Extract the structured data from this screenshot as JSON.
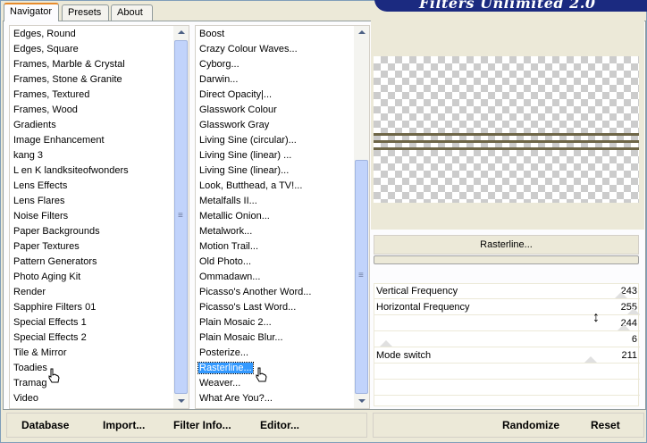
{
  "banner_title": "Filters Unlimited 2.0",
  "tabs": [
    {
      "label": "Navigator"
    },
    {
      "label": "Presets"
    },
    {
      "label": "About"
    }
  ],
  "categories": [
    "Edges, Round",
    "Edges, Square",
    "Frames, Marble & Crystal",
    "Frames, Stone & Granite",
    "Frames, Textured",
    "Frames, Wood",
    "Gradients",
    "Image Enhancement",
    "kang 3",
    "L en K landksiteofwonders",
    "Lens Effects",
    "Lens Flares",
    "Noise Filters",
    "Paper Backgrounds",
    "Paper Textures",
    "Pattern Generators",
    "Photo Aging Kit",
    "Render",
    "Sapphire Filters 01",
    "Special Effects 1",
    "Special Effects 2",
    "Tile & Mirror",
    "Toadies",
    "Tramag",
    "Video"
  ],
  "filters": [
    "Boost",
    "Crazy Colour Waves...",
    "Cyborg...",
    "Darwin...",
    "Direct Opacity|...",
    "Glasswork Colour",
    "Glasswork Gray",
    "Living Sine (circular)...",
    "Living Sine (linear) ...",
    "Living Sine (linear)...",
    "Look, Butthead, a TV!...",
    "Metalfalls II...",
    "Metallic Onion...",
    "Metalwork...",
    "Motion Trail...",
    "Old Photo...",
    "Ommadawn...",
    "Picasso's Another Word...",
    "Picasso's Last Word...",
    "Plain Mosaic 2...",
    "Plain Mosaic Blur...",
    "Posterize...",
    "Rasterline...",
    "Weaver...",
    "What Are You?..."
  ],
  "selected_filter_index": 22,
  "filter_name": "Rasterline...",
  "sliders": [
    {
      "label": "Vertical Frequency",
      "value": "243",
      "level": 0.95
    },
    {
      "label": "Horizontal Frequency",
      "value": "255",
      "level": 1.0
    },
    {
      "label": "",
      "value": "244",
      "level": 0.96
    },
    {
      "label": "",
      "value": "6",
      "level": 0.02
    },
    {
      "label": "Mode switch",
      "value": "211",
      "level": 0.83
    },
    {
      "label": "",
      "value": "",
      "level": null
    },
    {
      "label": "",
      "value": "",
      "level": null
    }
  ],
  "buttons": {
    "database": "Database",
    "import": "Import...",
    "filter_info": "Filter Info...",
    "editor": "Editor...",
    "randomize": "Randomize",
    "reset": "Reset"
  },
  "colors": {
    "selection": "#3399ff",
    "stripe": "#6e6647",
    "banner": "#1b2a80"
  }
}
